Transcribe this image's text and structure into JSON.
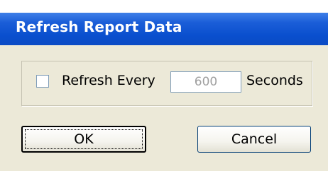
{
  "dialog": {
    "title": "Refresh Report Data",
    "refresh_label": "Refresh Every",
    "refresh_checked": false,
    "seconds_value": "600",
    "seconds_label": "Seconds",
    "ok_label": "OK",
    "cancel_label": "Cancel"
  },
  "colors": {
    "titlebar": "#0b4bc4",
    "window_bg": "#ece9d8",
    "input_border": "#7f9db9",
    "disabled_text": "#a0a0a0"
  }
}
